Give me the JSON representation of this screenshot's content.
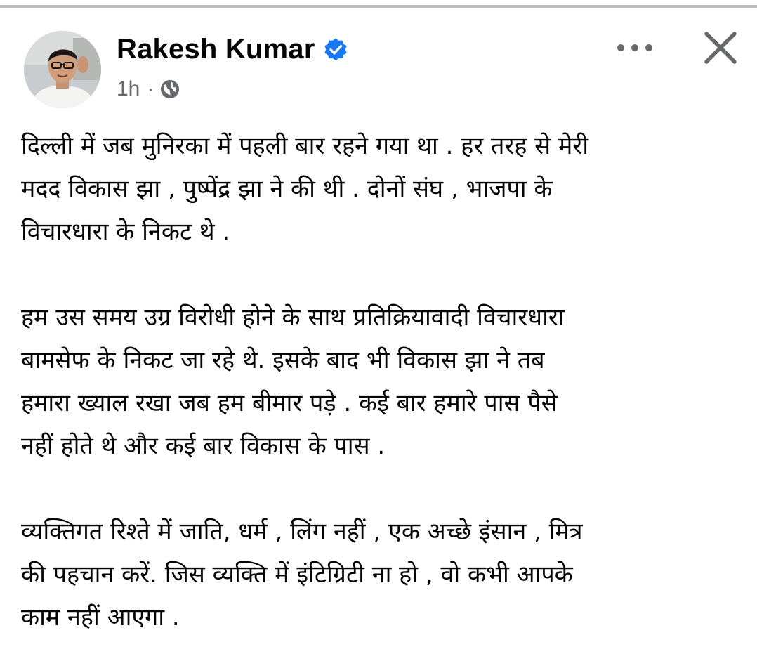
{
  "post": {
    "author": {
      "name": "Rakesh Kumar",
      "verified": true,
      "avatar_icon": "profile-photo"
    },
    "time": "1h",
    "separator": "·",
    "audience_icon": "globe-icon",
    "actions": {
      "more_icon": "more-horizontal-icon",
      "close_icon": "close-icon"
    },
    "paragraphs": [
      {
        "lines": [
          "दिल्ली में जब मुनिरका में पहली बार रहने गया था . हर तरह से मेरी",
          "मदद विकास झा  , पुष्पेंद्र झा ने की थी . दोनों संघ , भाजपा के",
          "विचारधारा के निकट थे ."
        ]
      },
      {
        "lines": [
          "हम उस समय उग्र विरोधी होने के साथ प्रतिक्रियावादी विचारधारा",
          "बामसेफ के निकट जा रहे थे. इसके बाद भी विकास झा ने तब",
          "हमारा ख्याल रखा जब हम बीमार पड़े . कई बार हमारे पास पैसे",
          "नहीं होते थे और कई बार विकास के पास ."
        ]
      },
      {
        "lines": [
          "व्यक्तिगत रिश्ते में जाति, धर्म , लिंग नहीं , एक अच्छे इंसान , मित्र",
          "की पहचान करें. जिस व्यक्ति में इंटिग्रिटी ना हो , वो कभी आपके",
          "काम नहीं आएगा ."
        ]
      }
    ]
  },
  "colors": {
    "verified_badge": "#1877f2",
    "meta_text": "#65676b",
    "body_text": "#050505",
    "divider": "#b9bcc0"
  }
}
